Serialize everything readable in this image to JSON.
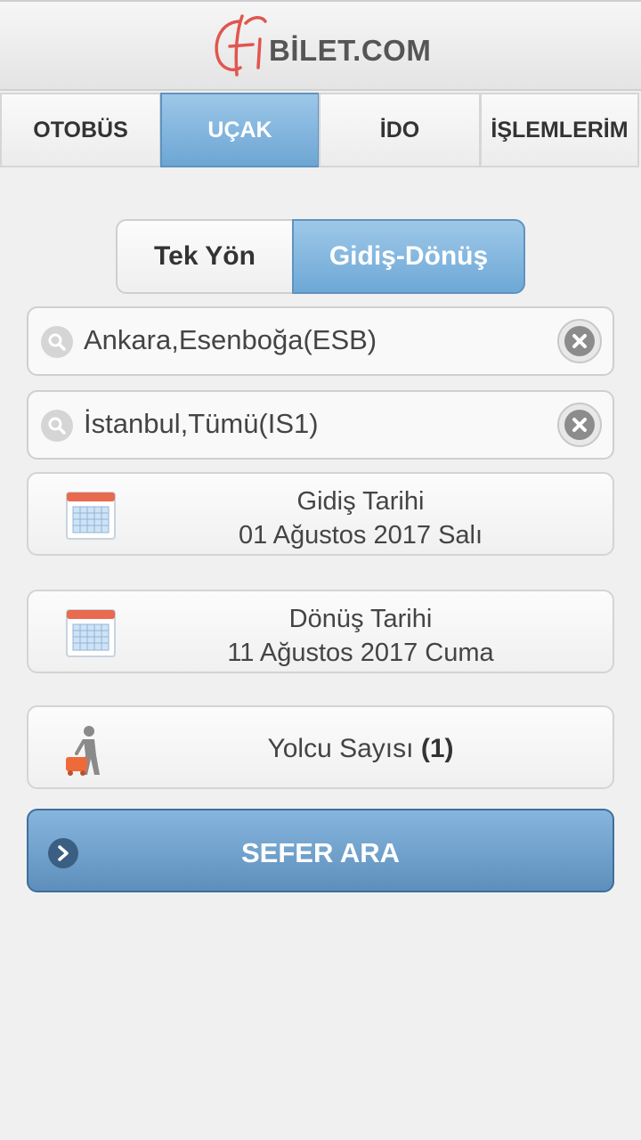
{
  "header": {
    "logo_text": "BİLET.COM"
  },
  "tabs": [
    {
      "label": "OTOBÜS",
      "active": false
    },
    {
      "label": "UÇAK",
      "active": true
    },
    {
      "label": "İDO",
      "active": false
    },
    {
      "label": "İŞLEMLERİM",
      "active": false
    }
  ],
  "trip_type": {
    "one_way": "Tek Yön",
    "round_trip": "Gidiş-Dönüş",
    "selected": "Gidiş-Dönüş"
  },
  "from": {
    "value": "Ankara,Esenboğa(ESB)"
  },
  "to": {
    "value": "İstanbul,Tümü(IS1)"
  },
  "departure": {
    "label": "Gidiş Tarihi",
    "date": "01 Ağustos 2017 Salı"
  },
  "return": {
    "label": "Dönüş Tarihi",
    "date": "11 Ağustos 2017 Cuma"
  },
  "passengers": {
    "label": "Yolcu Sayısı",
    "count": "(1)"
  },
  "search_button": {
    "label": "SEFER ARA"
  },
  "colors": {
    "accent": "#6da6d4",
    "accent_dark": "#5e8fbc",
    "background": "#f0f0f0",
    "logo_red": "#e0564f"
  }
}
